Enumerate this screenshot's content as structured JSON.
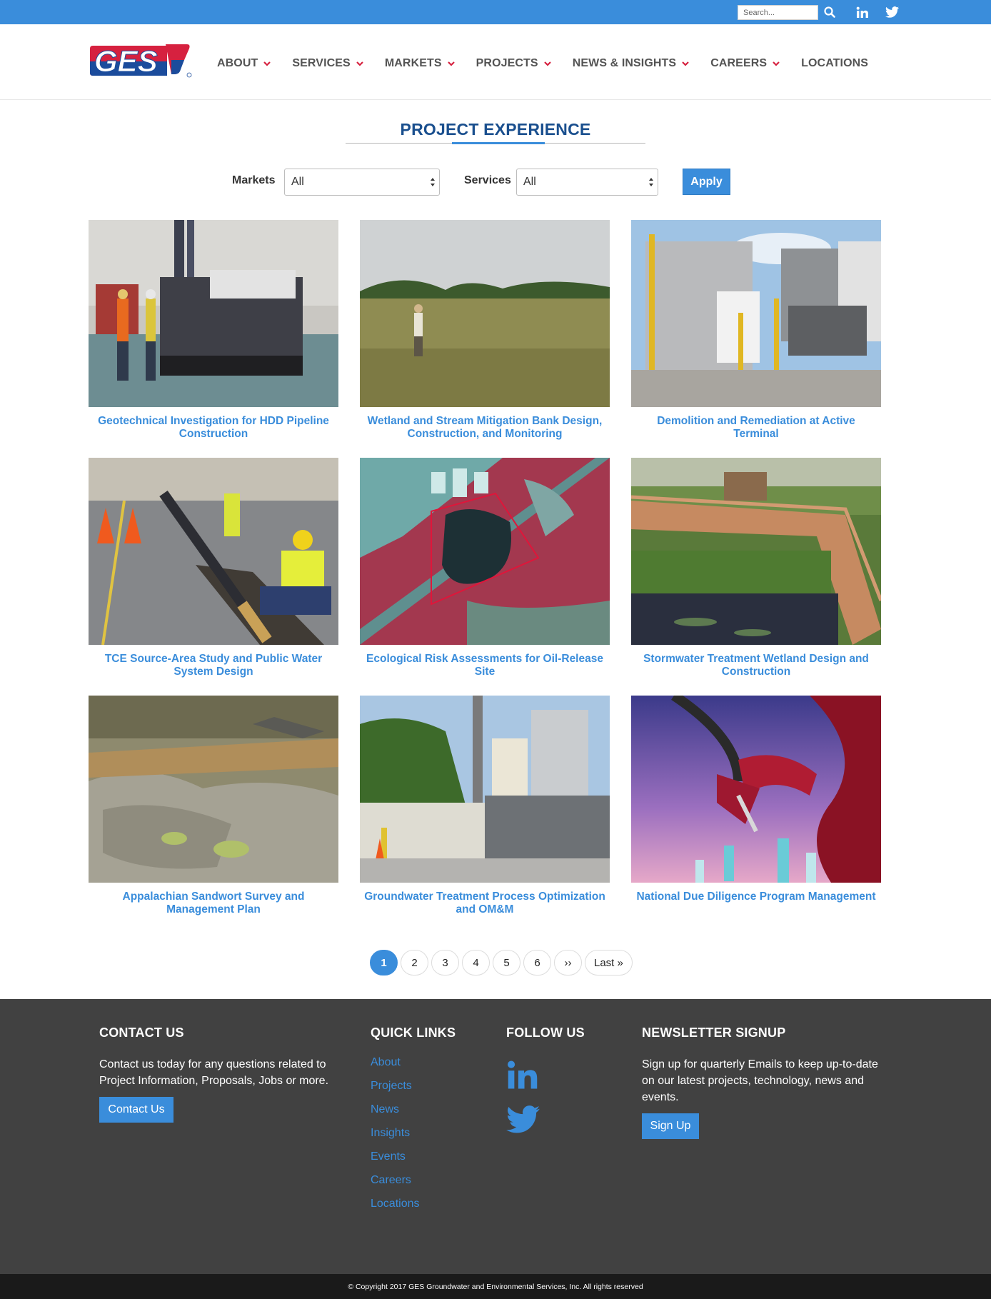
{
  "topbar": {
    "search_placeholder": "Search...",
    "icons": [
      "search-icon",
      "linkedin-icon",
      "twitter-icon"
    ]
  },
  "header": {
    "logo_text": "GES",
    "nav": [
      {
        "label": "ABOUT",
        "dropdown": true
      },
      {
        "label": "SERVICES",
        "dropdown": true
      },
      {
        "label": "MARKETS",
        "dropdown": true
      },
      {
        "label": "PROJECTS",
        "dropdown": true
      },
      {
        "label": "NEWS & INSIGHTS",
        "dropdown": true
      },
      {
        "label": "CAREERS",
        "dropdown": true
      },
      {
        "label": "LOCATIONS",
        "dropdown": false
      }
    ]
  },
  "page": {
    "title": "PROJECT EXPERIENCE"
  },
  "filters": {
    "markets_label": "Markets",
    "markets_value": "All",
    "services_label": "Services",
    "services_value": "All",
    "apply_label": "Apply"
  },
  "projects": [
    {
      "title": "Geotechnical Investigation for HDD Pipeline Construction"
    },
    {
      "title": "Wetland and Stream Mitigation Bank Design, Construction, and Monitoring"
    },
    {
      "title": "Demolition and Remediation at Active Terminal"
    },
    {
      "title": "TCE Source-Area Study and Public Water System Design"
    },
    {
      "title": "Ecological Risk Assessments for Oil-Release Site"
    },
    {
      "title": "Stormwater Treatment Wetland Design and Construction"
    },
    {
      "title": "Appalachian Sandwort Survey and Management Plan"
    },
    {
      "title": "Groundwater Treatment Process Optimization and OM&M"
    },
    {
      "title": "National Due Diligence Program Management"
    }
  ],
  "pagination": {
    "pages": [
      "1",
      "2",
      "3",
      "4",
      "5",
      "6"
    ],
    "current": "1",
    "next_label": "››",
    "last_label": "Last »"
  },
  "footer": {
    "contact": {
      "heading": "CONTACT US",
      "text": "Contact us today for any questions related to Project Information, Proposals, Jobs or more.",
      "button": "Contact Us"
    },
    "quick_links": {
      "heading": "QUICK LINKS",
      "links": [
        "About",
        "Projects",
        "News",
        "Insights",
        "Events",
        "Careers",
        "Locations"
      ]
    },
    "follow": {
      "heading": "FOLLOW US"
    },
    "newsletter": {
      "heading": "NEWSLETTER SIGNUP",
      "text": "Sign up for quarterly Emails to keep up-to-date on our latest projects, technology, news and events.",
      "button": "Sign Up"
    },
    "copyright": "© Copyright 2017 GES Groundwater and Environmental Services, Inc. All rights reserved"
  },
  "colors": {
    "brand_blue": "#3a8ddb",
    "title_navy": "#1a4f8e",
    "logo_red": "#d6213f",
    "footer_bg": "#414141"
  }
}
